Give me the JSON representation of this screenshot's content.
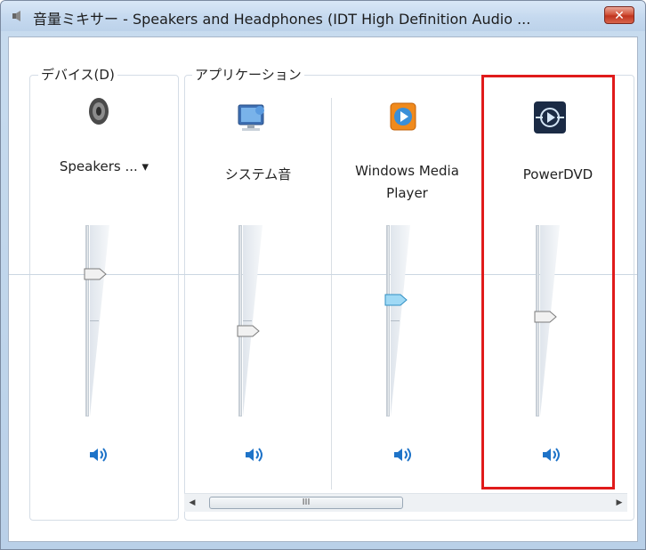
{
  "window": {
    "title": "音量ミキサー - Speakers and Headphones (IDT High Definition Audio ...",
    "close_glyph": "✕"
  },
  "device_group": {
    "label": "デバイス(D)",
    "device_name": "Speakers ... ▾",
    "volume_percent": 72
  },
  "apps_group": {
    "label": "アプリケーション",
    "apps": [
      {
        "name": "システム音",
        "icon": "system-sounds-icon",
        "volume_percent": 45
      },
      {
        "name_line1": "Windows Media",
        "name_line2": "Player",
        "icon": "windows-media-player-icon",
        "volume_percent": 72
      },
      {
        "name": "PowerDVD",
        "icon": "powerdvd-icon",
        "volume_percent": 52
      }
    ]
  },
  "scrollbar": {
    "grip": "III"
  },
  "colors": {
    "highlight": "#e01b1b",
    "accent": "#1e73c8"
  }
}
